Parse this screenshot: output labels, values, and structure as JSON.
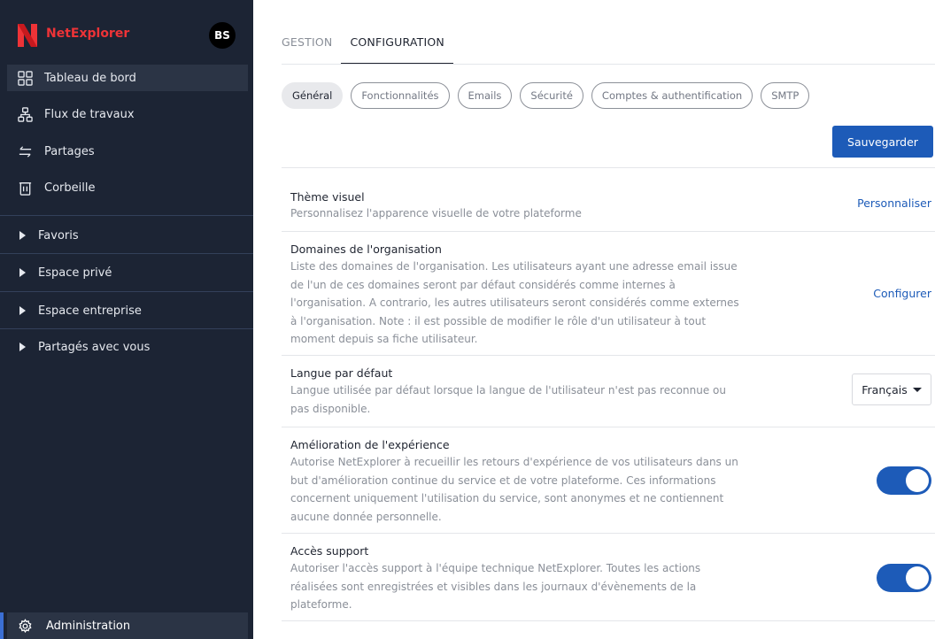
{
  "app": {
    "brand": "NetExplorer",
    "avatar_initials": "BS"
  },
  "colors": {
    "sidebar_bg": "#1c2434",
    "accent": "#1d5bb8",
    "brand_red": "#ee3337"
  },
  "sidebar": {
    "nav": [
      {
        "label": "Tableau de bord",
        "icon": "dashboard-icon",
        "active": true
      },
      {
        "label": "Flux de travaux",
        "icon": "workflow-icon",
        "active": false
      },
      {
        "label": "Partages",
        "icon": "share-arrows-icon",
        "active": false
      },
      {
        "label": "Corbeille",
        "icon": "trash-icon",
        "active": false
      }
    ],
    "sections": [
      {
        "label": "Favoris"
      },
      {
        "label": "Espace privé"
      },
      {
        "label": "Espace entreprise"
      },
      {
        "label": "Partagés avec vous"
      }
    ],
    "admin_label": "Administration"
  },
  "tabs": [
    {
      "label": "GESTION",
      "active": false
    },
    {
      "label": "CONFIGURATION",
      "active": true
    }
  ],
  "pills": [
    {
      "label": "Général",
      "active": true
    },
    {
      "label": "Fonctionnalités",
      "active": false
    },
    {
      "label": "Emails",
      "active": false
    },
    {
      "label": "Sécurité",
      "active": false
    },
    {
      "label": "Comptes & authentification",
      "active": false
    },
    {
      "label": "SMTP",
      "active": false
    }
  ],
  "save_label": "Sauvegarder",
  "settings": {
    "theme": {
      "title": "Thème visuel",
      "desc_lines": [
        "Personnalisez l'apparence visuelle de votre plateforme"
      ],
      "action": "Personnaliser"
    },
    "domains": {
      "title": "Domaines de l'organisation",
      "desc_lines": [
        "Liste des domaines de l'organisation. Les utilisateurs ayant une adresse email issue",
        "de l'un de ces domaines seront par défaut considérés comme internes à",
        "l'organisation. A contrario, les autres utilisateurs seront considérés comme externes",
        "à l'organisation. Note : il est possible de modifier le rôle d'un utilisateur à tout",
        "moment depuis sa fiche utilisateur."
      ],
      "action": "Configurer"
    },
    "language": {
      "title": "Langue par défaut",
      "desc_lines": [
        "Langue utilisée par défaut lorsque la langue de l'utilisateur n'est pas reconnue ou",
        "pas disponible."
      ],
      "selected": "Français"
    },
    "experience": {
      "title": "Amélioration de l'expérience",
      "desc_lines": [
        "Autorise NetExplorer à recueillir les retours d'expérience de vos utilisateurs dans un",
        "but d'amélioration continue du service et de votre plateforme. Ces informations",
        "concernent uniquement l'utilisation du service, sont anonymes et ne contiennent",
        "aucune donnée personnelle."
      ],
      "enabled": true
    },
    "support": {
      "title": "Accès support",
      "desc_lines": [
        "Autoriser l'accès support à l'équipe technique NetExplorer. Toutes les actions",
        "réalisées sont enregistrées et visibles dans les journaux d'évènements de la",
        "plateforme."
      ],
      "enabled": true
    }
  }
}
